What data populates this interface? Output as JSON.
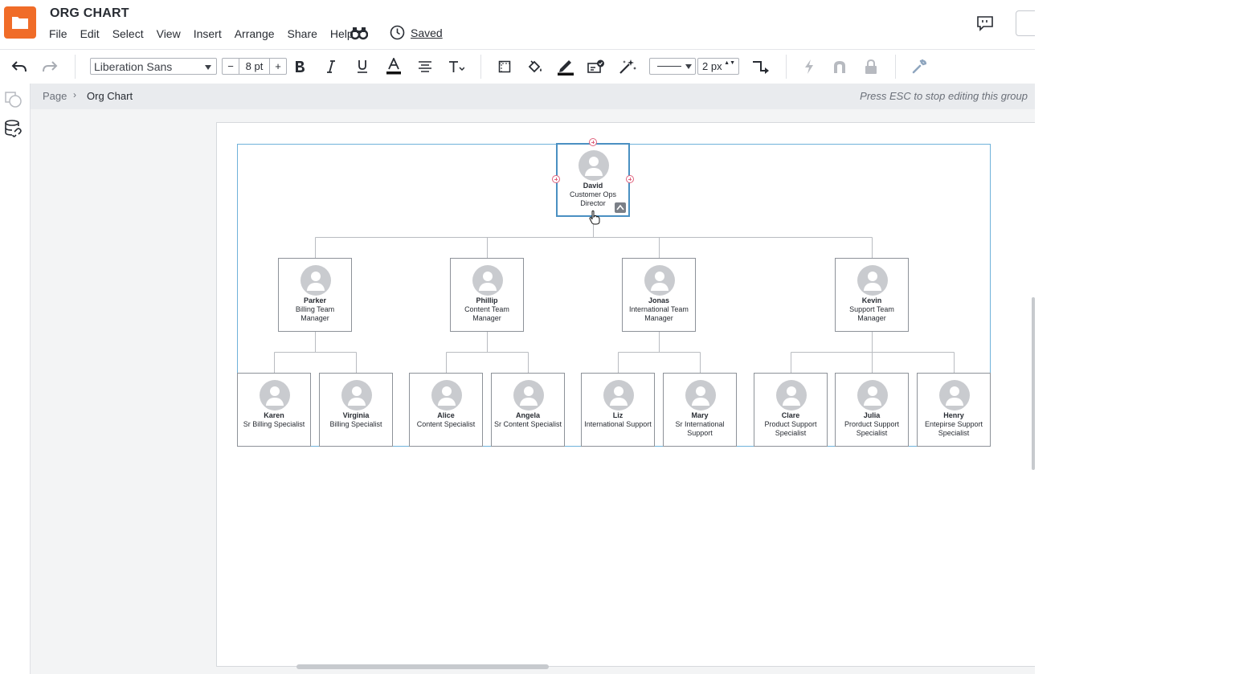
{
  "app": {
    "document_title": "ORG CHART",
    "menu": [
      "File",
      "Edit",
      "Select",
      "View",
      "Insert",
      "Arrange",
      "Share",
      "Help"
    ],
    "saved_label": "Saved",
    "accent_color": "#f06c28",
    "icons": {
      "logo": "folder-icon",
      "find": "binoculars-icon",
      "history": "clock-icon",
      "comments": "comment-icon"
    }
  },
  "toolbar": {
    "font_family": "Liberation Sans",
    "font_size": "8 pt",
    "size_minus": "−",
    "size_plus": "+",
    "line_width": "2 px",
    "line_width_arrows": "▲▼",
    "icons": [
      "undo-icon",
      "redo-icon",
      "bold-icon",
      "italic-icon",
      "underline-icon",
      "text-color-icon",
      "align-icon",
      "text-options-icon",
      "container-icon",
      "fill-color-icon",
      "line-color-icon",
      "conditional-format-icon",
      "magic-icon",
      "line-style-icon",
      "connector-icon",
      "lightning-icon",
      "magnet-icon",
      "lock-icon",
      "wrench-icon"
    ]
  },
  "breadcrumb": {
    "page": "Page",
    "separator": "›",
    "current": "Org Chart",
    "hint": "Press ESC to stop editing this group"
  },
  "org_chart": {
    "root": {
      "name": "David",
      "title": "Customer Ops Director",
      "selected": true
    },
    "managers": [
      {
        "name": "Parker",
        "title": "Billing Team Manager"
      },
      {
        "name": "Phillip",
        "title": "Content Team Manager"
      },
      {
        "name": "Jonas",
        "title": "International Team Manager"
      },
      {
        "name": "Kevin",
        "title": "Support Team Manager"
      }
    ],
    "staff": [
      {
        "name": "Karen",
        "title": "Sr Billing Specialist",
        "manager": "Parker"
      },
      {
        "name": "Virginia",
        "title": "Billing Specialist",
        "manager": "Parker"
      },
      {
        "name": "Alice",
        "title": "Content Specialist",
        "manager": "Phillip"
      },
      {
        "name": "Angela",
        "title": "Sr Content Specialist",
        "manager": "Phillip"
      },
      {
        "name": "Liz",
        "title": "International Support",
        "manager": "Jonas"
      },
      {
        "name": "Mary",
        "title": "Sr International Support",
        "manager": "Jonas"
      },
      {
        "name": "Clare",
        "title": "Product Support Specialist",
        "manager": "Kevin"
      },
      {
        "name": "Julia",
        "title": "Prorduct Support Specialist",
        "manager": "Kevin"
      },
      {
        "name": "Henry",
        "title": "Entepirse Support Specialist",
        "manager": "Kevin"
      }
    ]
  }
}
